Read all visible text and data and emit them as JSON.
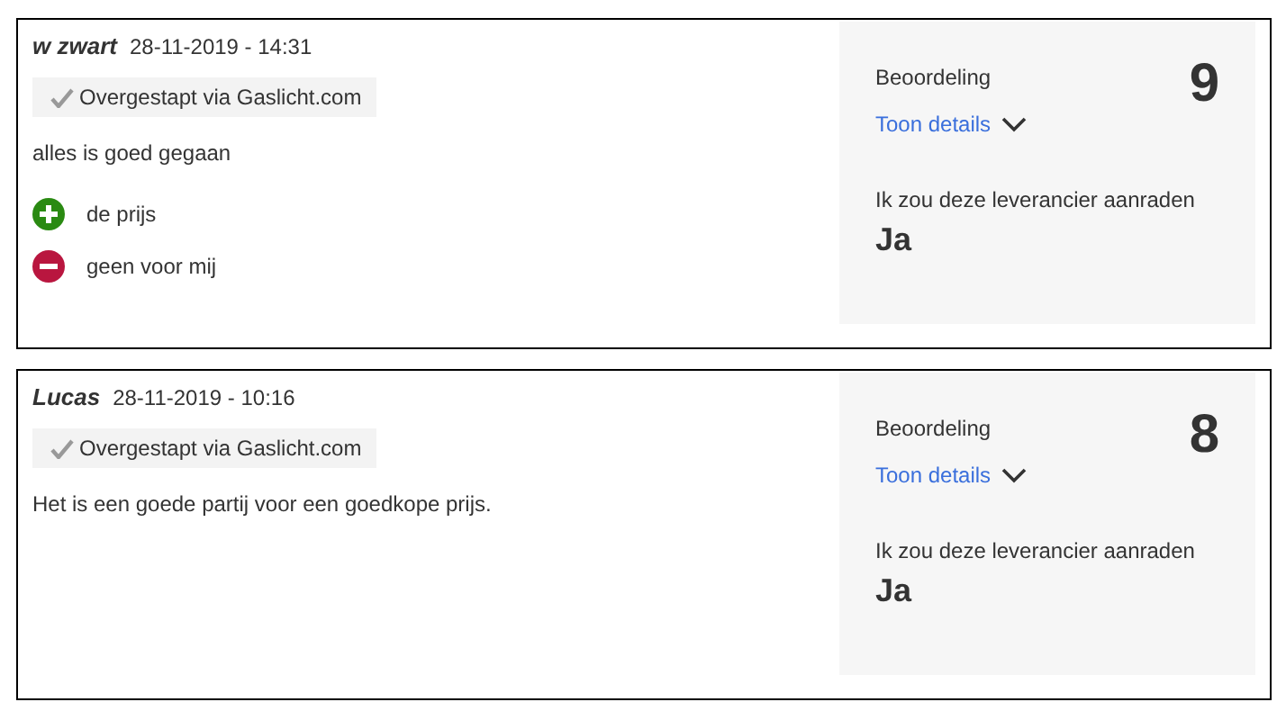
{
  "reviews": [
    {
      "author": "w zwart",
      "date": "28-11-2019 - 14:31",
      "badge": "Overgestapt via Gaslicht.com",
      "text": "alles is goed gegaan",
      "points": [
        {
          "kind": "plus",
          "text": "de prijs"
        },
        {
          "kind": "minus",
          "text": "geen voor mij"
        }
      ],
      "rating_label": "Beoordeling",
      "rating": "9",
      "details_link": "Toon details",
      "recommend_label": "Ik zou deze leverancier aanraden",
      "recommend": "Ja"
    },
    {
      "author": "Lucas",
      "date": "28-11-2019 - 10:16",
      "badge": "Overgestapt via Gaslicht.com",
      "text": "Het is een goede partij voor een goedkope prijs.",
      "rating_label": "Beoordeling",
      "rating": "8",
      "details_link": "Toon details",
      "recommend_label": "Ik zou deze leverancier aanraden",
      "recommend": "Ja"
    }
  ]
}
